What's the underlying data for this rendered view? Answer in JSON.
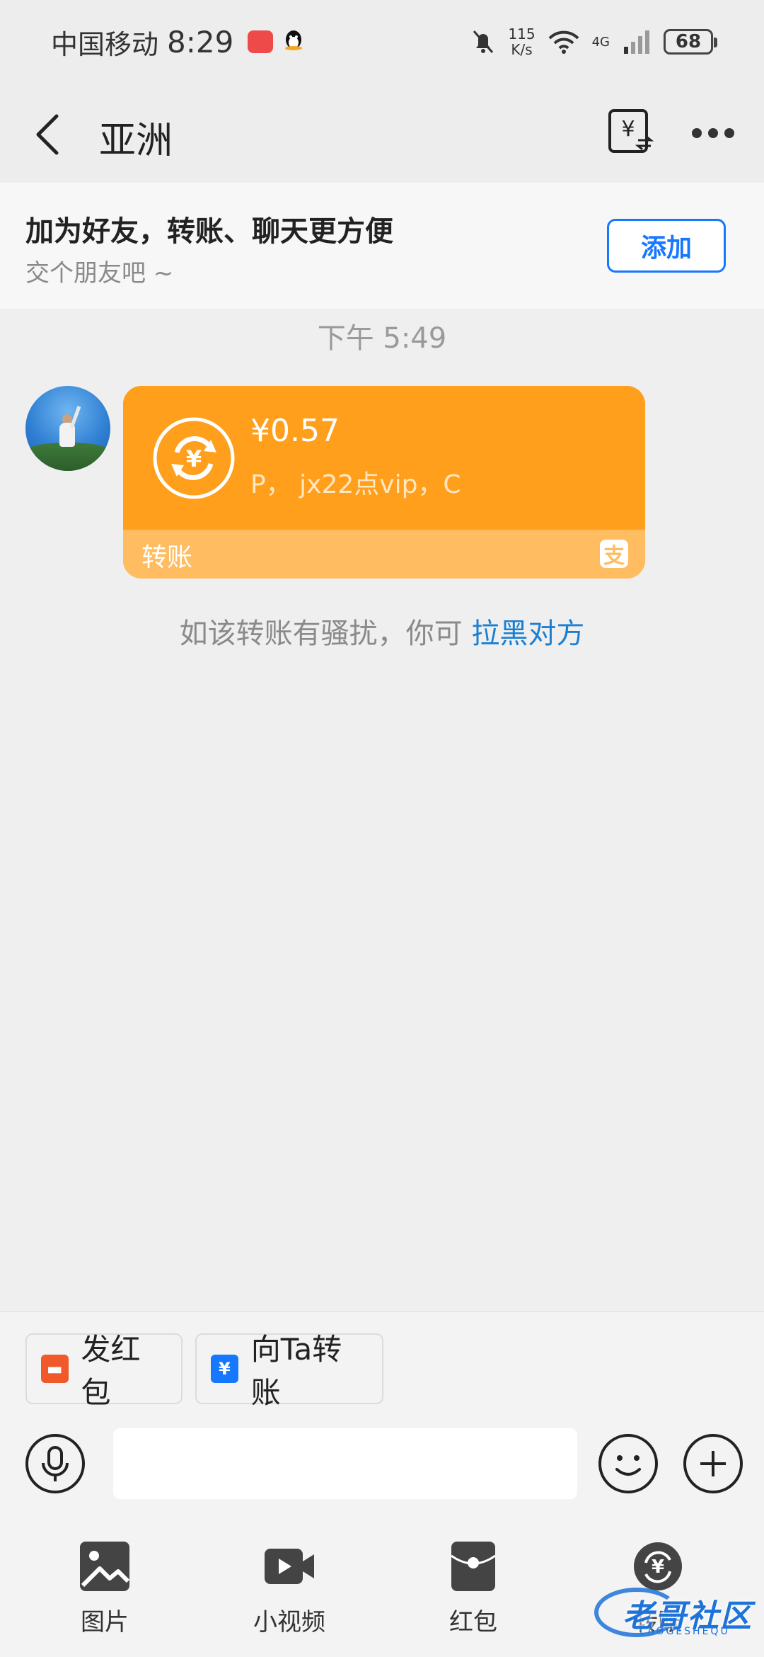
{
  "status_bar": {
    "carrier": "中国移动",
    "time": "8:29",
    "net_speed_value": "115",
    "net_speed_unit": "K/s",
    "network_type": "4G",
    "battery": "68"
  },
  "header": {
    "title": "亚洲"
  },
  "friend_banner": {
    "title": "加为好友，转账、聊天更方便",
    "subtitle": "交个朋友吧 ~",
    "add_label": "添加"
  },
  "chat": {
    "timestamp": "下午 5:49",
    "transfer": {
      "amount": "¥0.57",
      "note": "P， jx22点vip，C",
      "footer_label": "转账",
      "brand_icon": "alipay-icon"
    },
    "hint_text": "如该转账有骚扰，你可 ",
    "hint_link": "拉黑对方"
  },
  "quick_actions": [
    {
      "label": "发红包",
      "icon": "red-packet-icon"
    },
    {
      "label": "向Ta转账",
      "icon": "transfer-icon"
    }
  ],
  "input": {
    "placeholder": ""
  },
  "toolbar": [
    {
      "label": "图片",
      "icon": "image-icon"
    },
    {
      "label": "小视频",
      "icon": "video-icon"
    },
    {
      "label": "红包",
      "icon": "red-packet-icon"
    },
    {
      "label": "转账",
      "icon": "transfer-icon"
    }
  ],
  "watermark": {
    "text": "老哥社区",
    "sub": "LAOGESHEQU"
  },
  "colors": {
    "accent_blue": "#1677ff",
    "transfer_orange": "#ff9f1c",
    "transfer_footer": "#ffbc61",
    "link_blue": "#1c7fd0"
  }
}
